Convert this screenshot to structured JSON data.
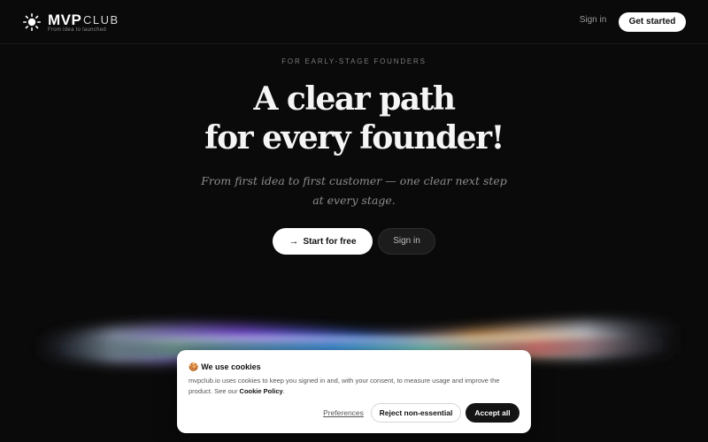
{
  "header": {
    "logo_bold": "MVP",
    "logo_light": "CLUB",
    "logo_tagline": "From idea to launched",
    "logo_icon": "sun-icon",
    "signin_label": "Sign in",
    "getstarted_label": "Get started"
  },
  "hero": {
    "eyebrow": "FOR EARLY-STAGE FOUNDERS",
    "headline_line1": "A clear path",
    "headline_line2": "for every founder!",
    "subhead_line1": "From first idea to first customer — one clear next step",
    "subhead_line2": "at every stage.",
    "primary_cta": "Start for free",
    "primary_cta_icon": "arrow-right-icon",
    "secondary_cta": "Sign in"
  },
  "cookie_banner": {
    "emoji": "🍪",
    "title": "We use cookies",
    "body": "mvpclub.io uses cookies to keep you signed in and, with your consent, to measure usage and improve the product. See our ",
    "policy_link": "Cookie Policy",
    "body_end": ".",
    "preferences_label": "Preferences",
    "reject_label": "Reject non-essential",
    "accept_label": "Accept all"
  },
  "colors": {
    "background": "#0a0a0a",
    "text_primary": "#f5f5f5",
    "text_muted": "#8c8c8c",
    "button_light": "#ffffff",
    "button_dark": "#141414"
  }
}
